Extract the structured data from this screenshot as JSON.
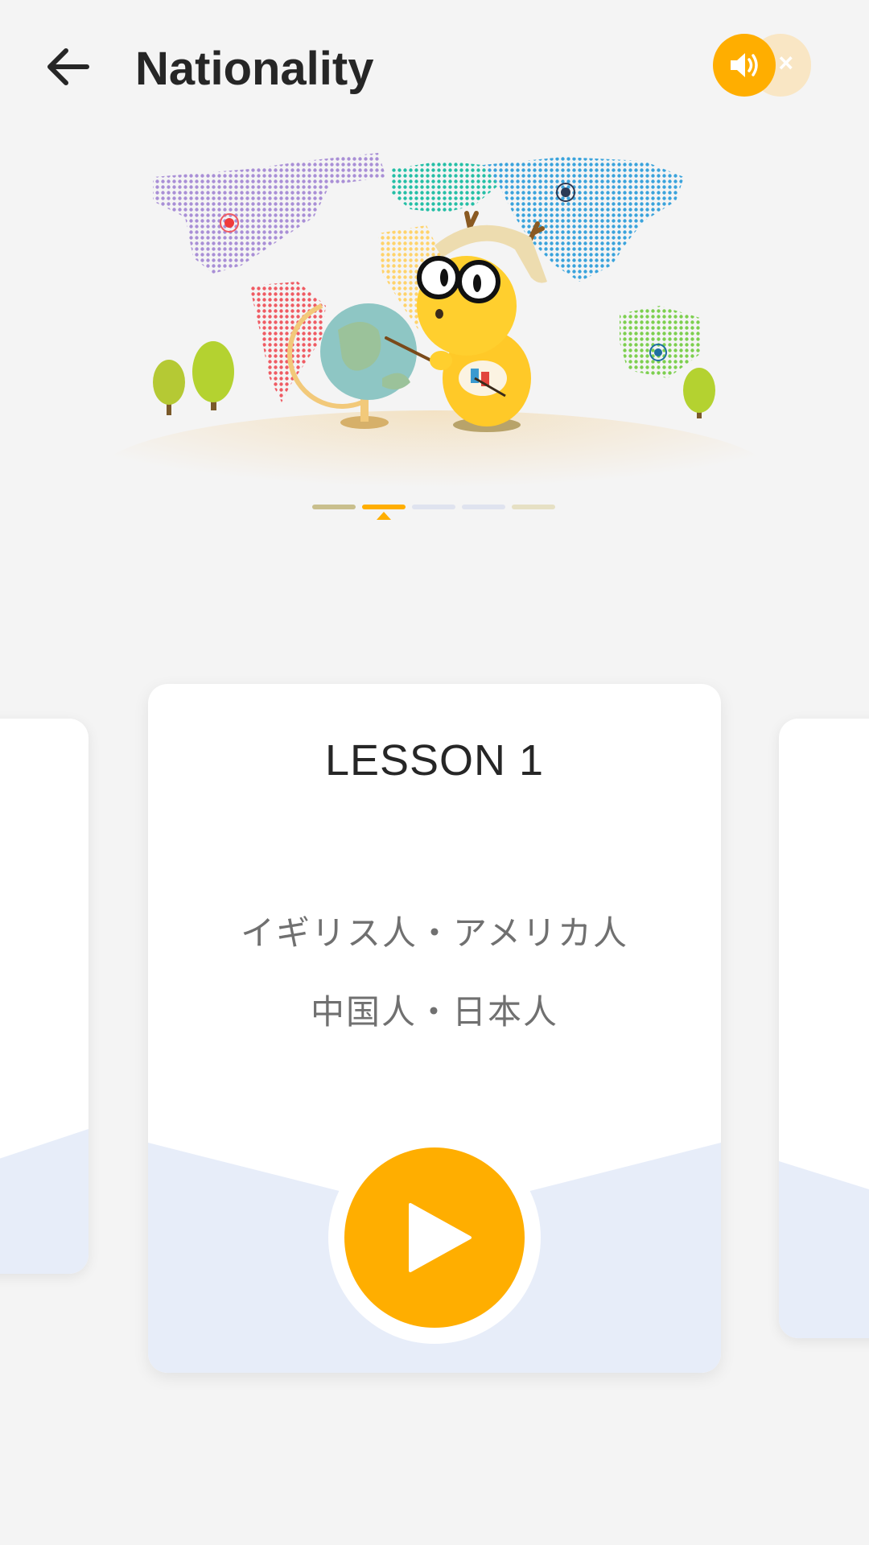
{
  "header": {
    "title": "Nationality",
    "back_icon": "arrow-left-icon",
    "sound_icon": "speaker-icon",
    "sound_off_mark": "×",
    "sound_on": true
  },
  "pager": {
    "count": 5,
    "active_index": 1,
    "colors": [
      "#c9bf8d",
      "#ffae00",
      "#dfe3ef",
      "#dfe3ef",
      "#e6e0c4"
    ]
  },
  "lesson": {
    "title": "LESSON 1",
    "line1": "イギリス人・アメリカ人",
    "line2": "中国人・日本人",
    "play_icon": "play-icon"
  },
  "colors": {
    "accent": "#ffae00",
    "background": "#f4f4f4",
    "card_wave": "#e7edf9"
  }
}
